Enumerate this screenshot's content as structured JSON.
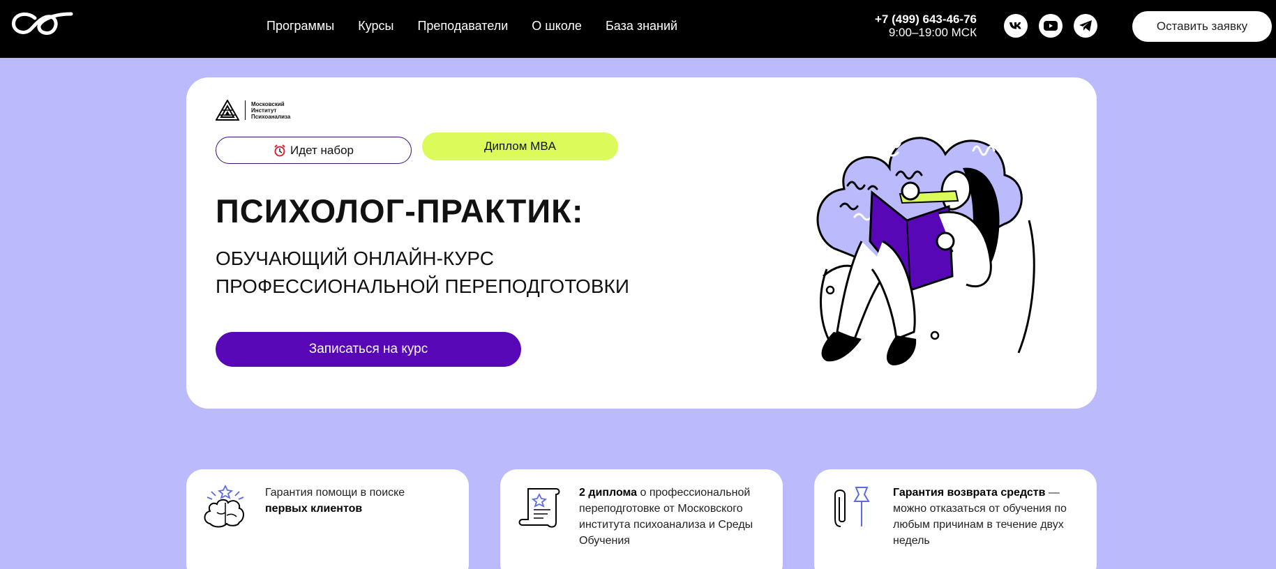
{
  "header": {
    "nav": [
      "Программы",
      "Курсы",
      "Преподаватели",
      "О школе",
      "База знаний"
    ],
    "phone": "+7 (499) 643-46-76",
    "hours": "9:00–19:00 МСК",
    "social": [
      "vk-icon",
      "youtube-icon",
      "telegram-icon"
    ],
    "apply_label": "Оставить заявку"
  },
  "hero": {
    "institute_name": "Московский\nИнститут\nПсихоанализа",
    "recruit_label": "Идет набор",
    "recruit_icon": "alarm-clock-icon",
    "badge_label": "Диплом MBA",
    "title": "ПСИХОЛОГ-ПРАКТИК:",
    "subtitle_line1": "Обучающий онлайн-курс",
    "subtitle_line2": "профессиональной переподготовки",
    "cta_label": "Записаться на курс"
  },
  "features": [
    {
      "icon": "brain-star-icon",
      "pre": "Гарантия помощи в поиске ",
      "bold": "первых клиентов",
      "post": ""
    },
    {
      "icon": "diploma-scroll-icon",
      "pre": "",
      "bold": "2 диплома",
      "post": " о профессиональной переподготовке от Московского института психоанализа и Среды Обучения"
    },
    {
      "icon": "paperclip-pin-icon",
      "pre": "",
      "bold": "Гарантия возврата средств",
      "post": " — можно отказаться от обучения по любым причинам в течение двух недель"
    }
  ],
  "colors": {
    "background": "#babafc",
    "accent_purple": "#5707b5",
    "lime": "#dbfb5a",
    "header": "#000000"
  }
}
